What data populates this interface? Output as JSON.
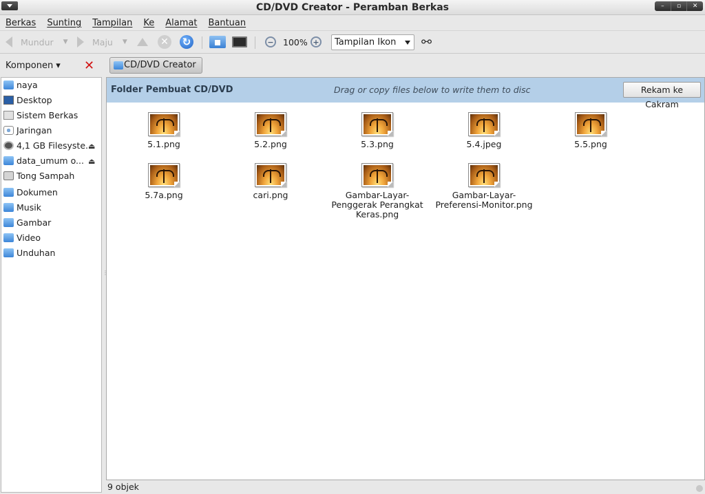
{
  "window": {
    "title": "CD/DVD Creator - Peramban Berkas",
    "controls": [
      "–",
      "▫",
      "✕"
    ]
  },
  "menubar": [
    "Berkas",
    "Sunting",
    "Tampilan",
    "Ke",
    "Alamat",
    "Bantuan"
  ],
  "toolbar": {
    "back_label": "Mundur",
    "forward_label": "Maju",
    "zoom_level": "100%",
    "view_mode": "Tampilan Ikon",
    "icons": [
      "back-icon",
      "forward-icon",
      "up-icon",
      "stop-icon",
      "reload-icon",
      "home-icon",
      "computer-icon",
      "zoom-out-icon",
      "zoom-in-icon",
      "search-binoculars-icon"
    ]
  },
  "sidebar": {
    "header": "Komponen ▾",
    "items": [
      {
        "label": "naya",
        "icon": "home-folder-icon"
      },
      {
        "label": "Desktop",
        "icon": "desktop-icon"
      },
      {
        "label": "Sistem Berkas",
        "icon": "filesystem-icon"
      },
      {
        "label": "Jaringan",
        "icon": "network-icon"
      },
      {
        "label": "4,1 GB Filesyste...",
        "icon": "drive-icon",
        "eject": true
      },
      {
        "label": "data_umum o...",
        "icon": "folder-icon",
        "eject": true
      },
      {
        "label": "Tong Sampah",
        "icon": "trash-icon"
      },
      {
        "label": "Dokumen",
        "icon": "folder-icon"
      },
      {
        "label": "Musik",
        "icon": "folder-icon"
      },
      {
        "label": "Gambar",
        "icon": "folder-icon"
      },
      {
        "label": "Video",
        "icon": "folder-icon"
      },
      {
        "label": "Unduhan",
        "icon": "folder-icon"
      }
    ]
  },
  "location": {
    "button_label": "CD/DVD Creator"
  },
  "burn_bar": {
    "title": "Folder Pembuat CD/DVD",
    "hint": "Drag or copy files below to write them to disc",
    "button_label": "Rekam ke Cakram"
  },
  "files": [
    {
      "name": "5.1.png"
    },
    {
      "name": "5.2.png"
    },
    {
      "name": "5.3.png"
    },
    {
      "name": "5.4.jpeg"
    },
    {
      "name": "5.5.png"
    },
    {
      "name": "5.7a.png"
    },
    {
      "name": "cari.png"
    },
    {
      "name": "Gambar-Layar-\nPenggerak Perangkat\nKeras.png"
    },
    {
      "name": "Gambar-Layar-\nPreferensi-Monitor.png"
    }
  ],
  "status": {
    "text": "9 objek"
  },
  "colors": {
    "burn_bar_bg": "#b4cfe8",
    "close_red": "#d11414",
    "folder_blue": "#3d86d8"
  }
}
